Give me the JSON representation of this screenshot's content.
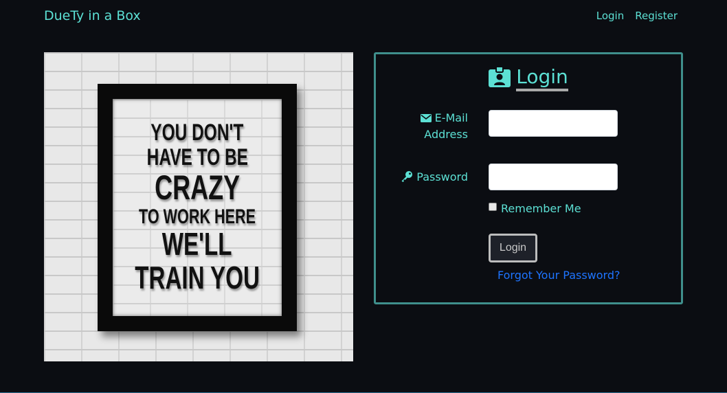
{
  "navbar": {
    "brand": "DueTy in a Box",
    "links": [
      {
        "label": "Login"
      },
      {
        "label": "Register"
      }
    ]
  },
  "poster": {
    "lines": [
      "YOU DON'T",
      "HAVE TO BE",
      "CRAZY",
      "TO WORK HERE",
      "WE'LL",
      "TRAIN YOU"
    ]
  },
  "login_card": {
    "title": "Login",
    "title_icon": "id-badge-icon",
    "email": {
      "label_line1": "E-Mail",
      "label_line2": "Address",
      "icon": "envelope-icon",
      "value": "",
      "placeholder": ""
    },
    "password": {
      "label": "Password",
      "icon": "key-icon",
      "value": "",
      "placeholder": ""
    },
    "remember_label": "Remember Me",
    "remember_checked": false,
    "submit_label": "Login",
    "forgot_label": "Forgot Your Password?"
  },
  "colors": {
    "background": "#0b0d12",
    "accent": "#5ce0d4",
    "card_border": "#3f8f8c",
    "link": "#1e74ff"
  }
}
